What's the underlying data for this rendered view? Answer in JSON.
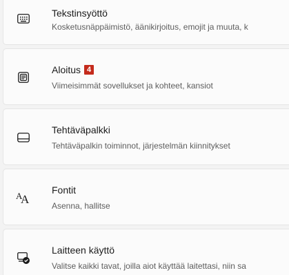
{
  "items": [
    {
      "title": "Tekstinsyöttö",
      "description": "Kosketusnäppäimistö, äänikirjoitus, emojit ja muuta, k",
      "icon": "keyboard-icon"
    },
    {
      "title": "Aloitus",
      "badge": "4",
      "description": "Viimeisimmät sovellukset ja kohteet, kansiot",
      "icon": "start-menu-icon"
    },
    {
      "title": "Tehtäväpalkki",
      "description": "Tehtäväpalkin toiminnot, järjestelmän kiinnitykset",
      "icon": "taskbar-icon"
    },
    {
      "title": "Fontit",
      "description": "Asenna, hallitse",
      "icon": "fonts-icon"
    },
    {
      "title": "Laitteen käyttö",
      "description": "Valitse kaikki tavat, joilla aiot käyttää laitettasi, niin sa",
      "icon": "device-usage-icon"
    }
  ],
  "colors": {
    "badge": "#c42b1c",
    "background": "#f3f3f3",
    "card": "#fbfbfb"
  }
}
